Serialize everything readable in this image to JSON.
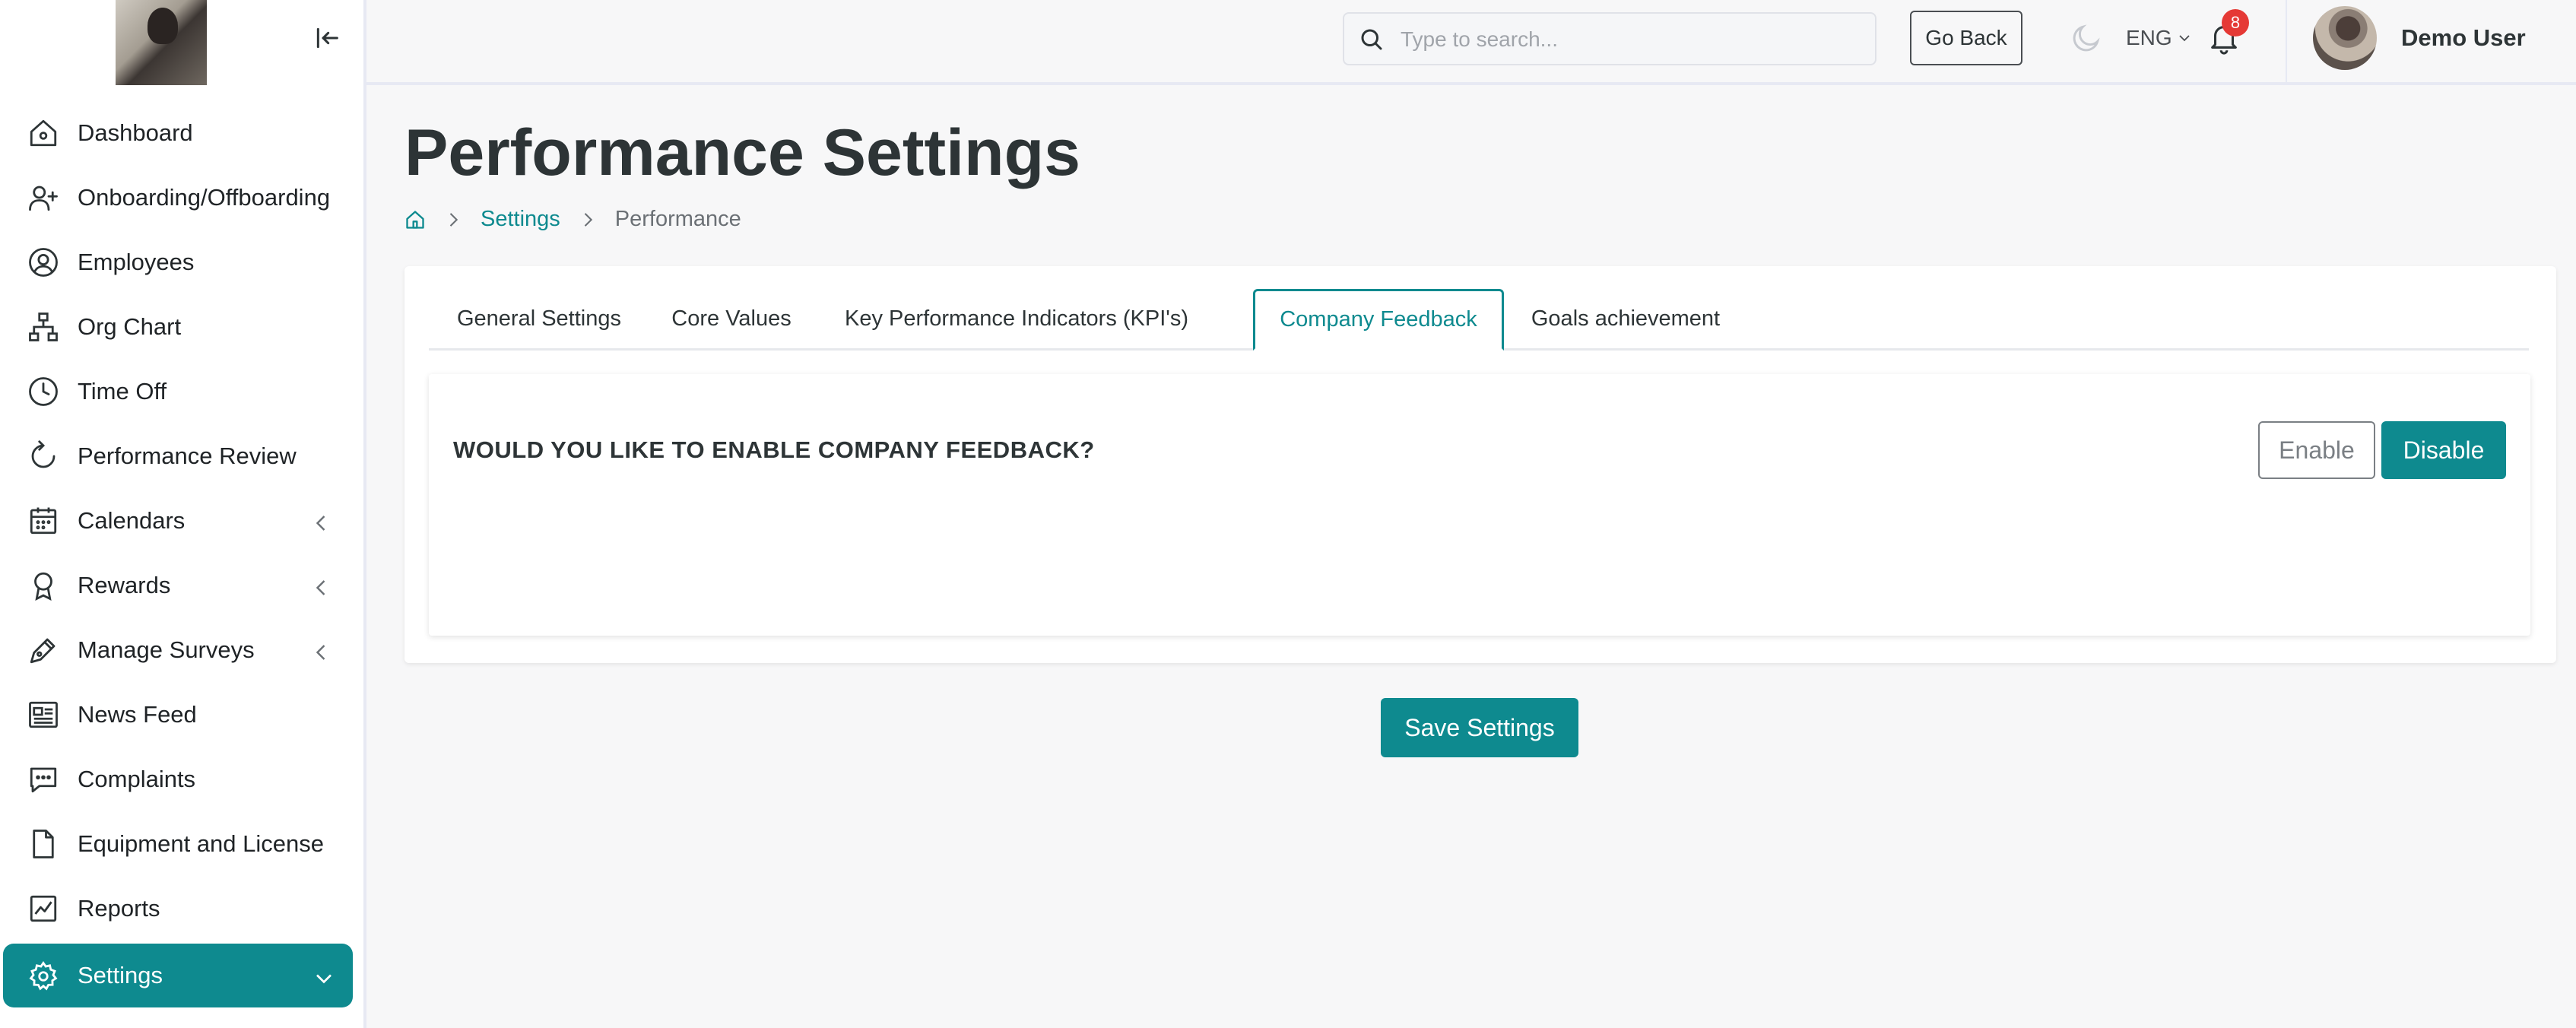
{
  "sidebar": {
    "logo_alt": "company logo",
    "items": [
      {
        "label": "Dashboard",
        "icon": "home-icon"
      },
      {
        "label": "Onboarding/Offboarding",
        "icon": "user-plus-icon"
      },
      {
        "label": "Employees",
        "icon": "user-circle-icon"
      },
      {
        "label": "Org Chart",
        "icon": "org-chart-icon"
      },
      {
        "label": "Time Off",
        "icon": "clock-icon"
      },
      {
        "label": "Performance Review",
        "icon": "refresh-icon"
      },
      {
        "label": "Calendars",
        "icon": "calendar-icon"
      },
      {
        "label": "Rewards",
        "icon": "award-icon"
      },
      {
        "label": "Manage Surveys",
        "icon": "pen-icon"
      },
      {
        "label": "News Feed",
        "icon": "newspaper-icon"
      },
      {
        "label": "Complaints",
        "icon": "message-icon"
      },
      {
        "label": "Equipment and License",
        "icon": "file-icon"
      },
      {
        "label": "Reports",
        "icon": "chart-icon"
      },
      {
        "label": "Settings",
        "icon": "gear-icon"
      }
    ]
  },
  "topbar": {
    "search_placeholder": "Type to search...",
    "go_back_label": "Go Back",
    "language": "ENG",
    "notification_count": "8",
    "user_name": "Demo User"
  },
  "page": {
    "title": "Performance Settings",
    "breadcrumb": [
      "Settings",
      "Performance"
    ]
  },
  "tabs": [
    {
      "label": "General Settings"
    },
    {
      "label": "Core Values"
    },
    {
      "label": "Key Performance Indicators (KPI's)"
    },
    {
      "label": "Company Feedback"
    },
    {
      "label": "Goals achievement"
    }
  ],
  "active_tab": "Company Feedback",
  "feedback": {
    "question": "WOULD YOU LIKE TO ENABLE COMPANY FEEDBACK?",
    "enable_label": "Enable",
    "disable_label": "Disable",
    "selected": "Disable"
  },
  "save_label": "Save Settings",
  "colors": {
    "accent": "#0e8a8f",
    "badge": "#e53935",
    "text": "#2d3436"
  }
}
